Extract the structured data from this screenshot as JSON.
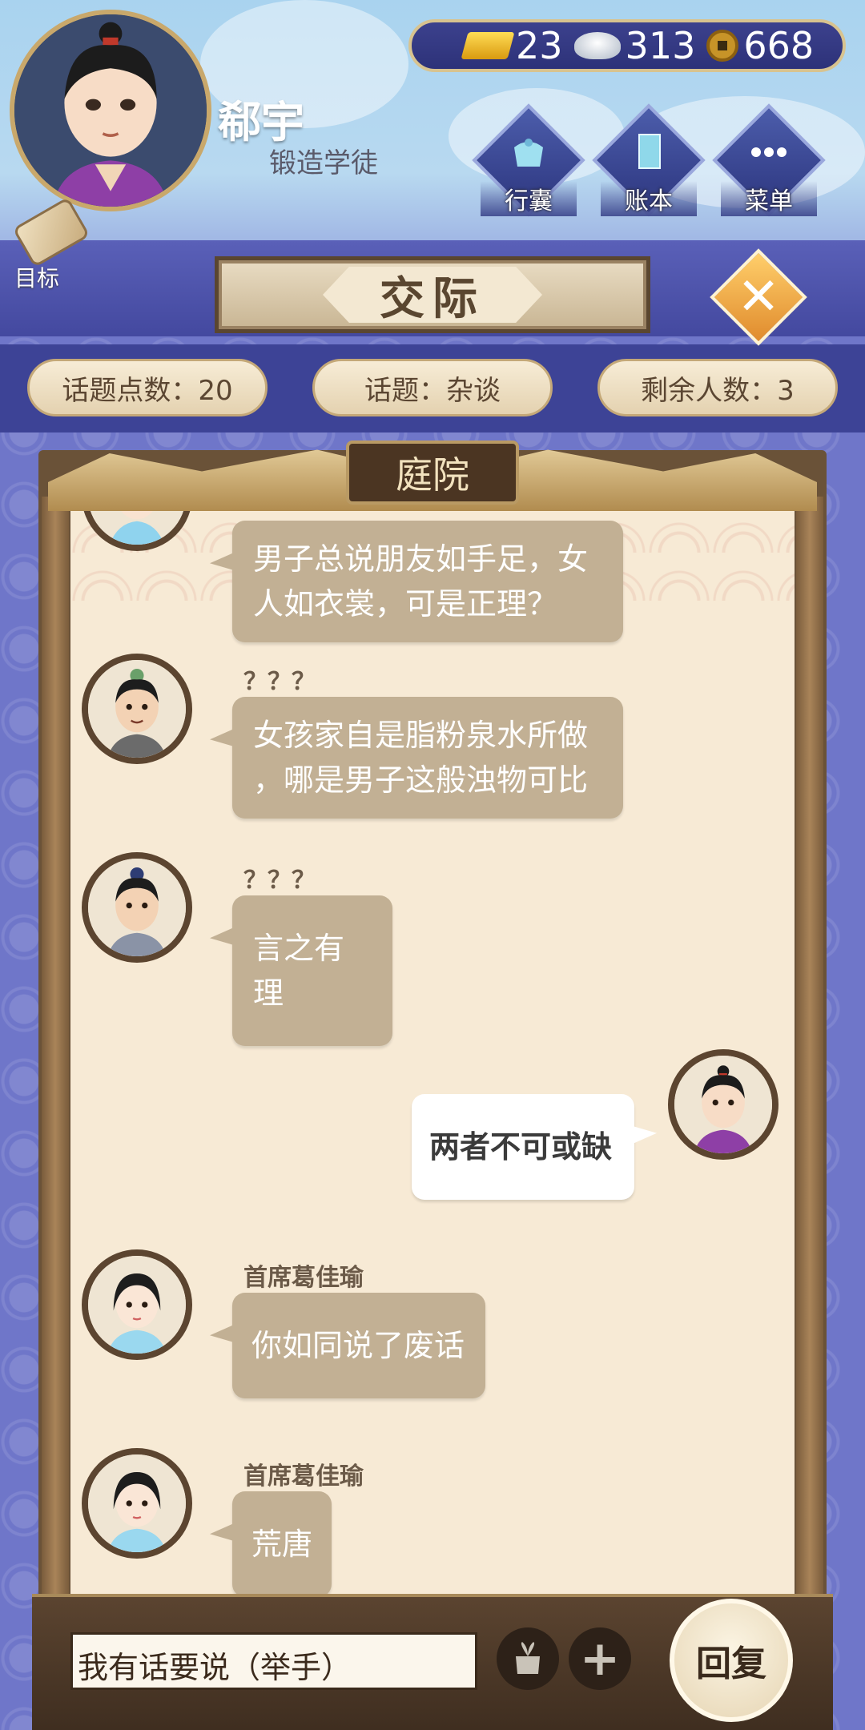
{
  "header": {
    "player_name": "郗宇",
    "player_title": "锻造学徒",
    "goal_label": "目标",
    "currency": {
      "gold": "23",
      "silver": "313",
      "copper": "668"
    },
    "menu": [
      {
        "label": "行囊",
        "icon": "bag-icon"
      },
      {
        "label": "账本",
        "icon": "ledger-icon"
      },
      {
        "label": "菜单",
        "icon": "more-icon"
      }
    ]
  },
  "panel": {
    "title": "交际",
    "stats": {
      "topic_points": "话题点数：20",
      "topic": "话题：杂谈",
      "remaining": "剩余人数：3"
    },
    "location": "庭院"
  },
  "messages": [
    {
      "sender": "",
      "text_lines": [
        "男子总说朋友如手足，女",
        "人如衣裳，可是正理？"
      ],
      "mine": false
    },
    {
      "sender": "？？？",
      "text_lines": [
        "女孩家自是脂粉泉水所做",
        "，哪是男子这般浊物可比"
      ],
      "mine": false
    },
    {
      "sender": "？？？",
      "text_lines": [
        "言之有理"
      ],
      "mine": false
    },
    {
      "sender": "",
      "text_lines": [
        "两者不可或缺"
      ],
      "mine": true
    },
    {
      "sender": "首席葛佳瑜",
      "text_lines": [
        "你如同说了废话"
      ],
      "mine": false
    },
    {
      "sender": "首席葛佳瑜",
      "text_lines": [
        "荒唐"
      ],
      "mine": false
    }
  ],
  "footer": {
    "input_text": "我有话要说（举手）",
    "reply_label": "回复",
    "plus_symbol": "+"
  }
}
